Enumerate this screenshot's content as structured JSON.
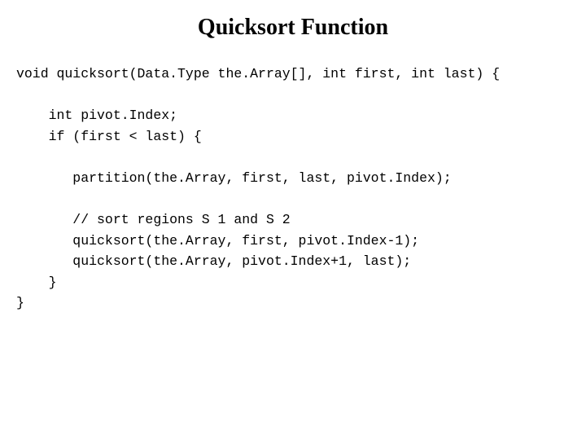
{
  "title": "Quicksort Function",
  "code": {
    "l1": "void quicksort(Data.Type the.Array[], int first, int last) {",
    "l2": "",
    "l3": "    int pivot.Index;",
    "l4": "    if (first < last) {",
    "l5": "",
    "l6": "       partition(the.Array, first, last, pivot.Index);",
    "l7": "",
    "l8": "       // sort regions S 1 and S 2",
    "l9": "       quicksort(the.Array, first, pivot.Index-1);",
    "l10": "       quicksort(the.Array, pivot.Index+1, last);",
    "l11": "    }",
    "l12": "}"
  }
}
